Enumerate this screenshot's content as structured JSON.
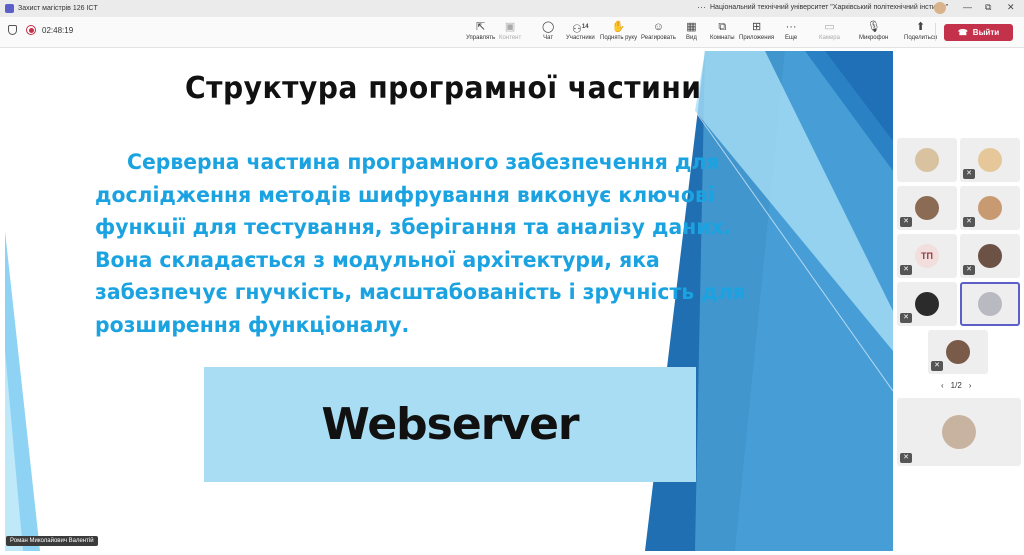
{
  "window": {
    "title": "Захист магістрів 126 ICT",
    "organization": "Національний технічний університет \"Харківський політехнічний інститут\"",
    "controls": {
      "minimize": "—",
      "maximize": "⧉",
      "close": "✕"
    }
  },
  "meeting": {
    "timer": "02:48:19",
    "toolbar": {
      "share_control": "Управлять",
      "content": "Контент",
      "chat": "Чат",
      "participants": "Участники",
      "participants_count": "14",
      "raise_hand": "Поднять руку",
      "react": "Реагировать",
      "view": "Вид",
      "rooms": "Комнаты",
      "apps": "Приложения",
      "more": "Еще",
      "camera": "Камера",
      "mic": "Микрофон",
      "share": "Поделиться",
      "leave": "Выйти"
    }
  },
  "slide": {
    "title": "Структура програмної частини",
    "body": "Серверна частина програмного забезпечення для дослідження методів шифрування виконує ключові функції для тестування, зберігання та аналізу даних. Вона складається з модульної архітектури, яка забезпечує гнучкість, масштабованість і зручність для розширення функціоналу.",
    "box_label": "Webserver",
    "colors": {
      "body_text": "#1aa3e0",
      "box_bg": "#a9ddf3",
      "deco_blue": "#1f6fb2",
      "deco_light": "#8fd3f4"
    }
  },
  "presenter_name": "Роман Миколайович Валентій",
  "gallery": {
    "participants": [
      {
        "initials": "",
        "avatar_color": "#d8c2a0",
        "muted": false
      },
      {
        "initials": "",
        "avatar_color": "#e6c79a",
        "muted": true
      },
      {
        "initials": "",
        "avatar_color": "#8c6b55",
        "muted": true
      },
      {
        "initials": "",
        "avatar_color": "#c89a72",
        "muted": true
      },
      {
        "initials": "ТП",
        "avatar_color": "#f3dede",
        "muted": true
      },
      {
        "initials": "",
        "avatar_color": "#6b5244",
        "muted": true
      },
      {
        "initials": "",
        "avatar_color": "#2b2b2b",
        "muted": true
      },
      {
        "initials": "",
        "avatar_color": "#b9b9c2",
        "muted": false
      },
      {
        "initials": "",
        "avatar_color": "#7a5a48",
        "muted": true
      },
      {
        "initials": "",
        "avatar_color": "#c7b3a0",
        "muted": true
      }
    ],
    "page": "1/2"
  }
}
